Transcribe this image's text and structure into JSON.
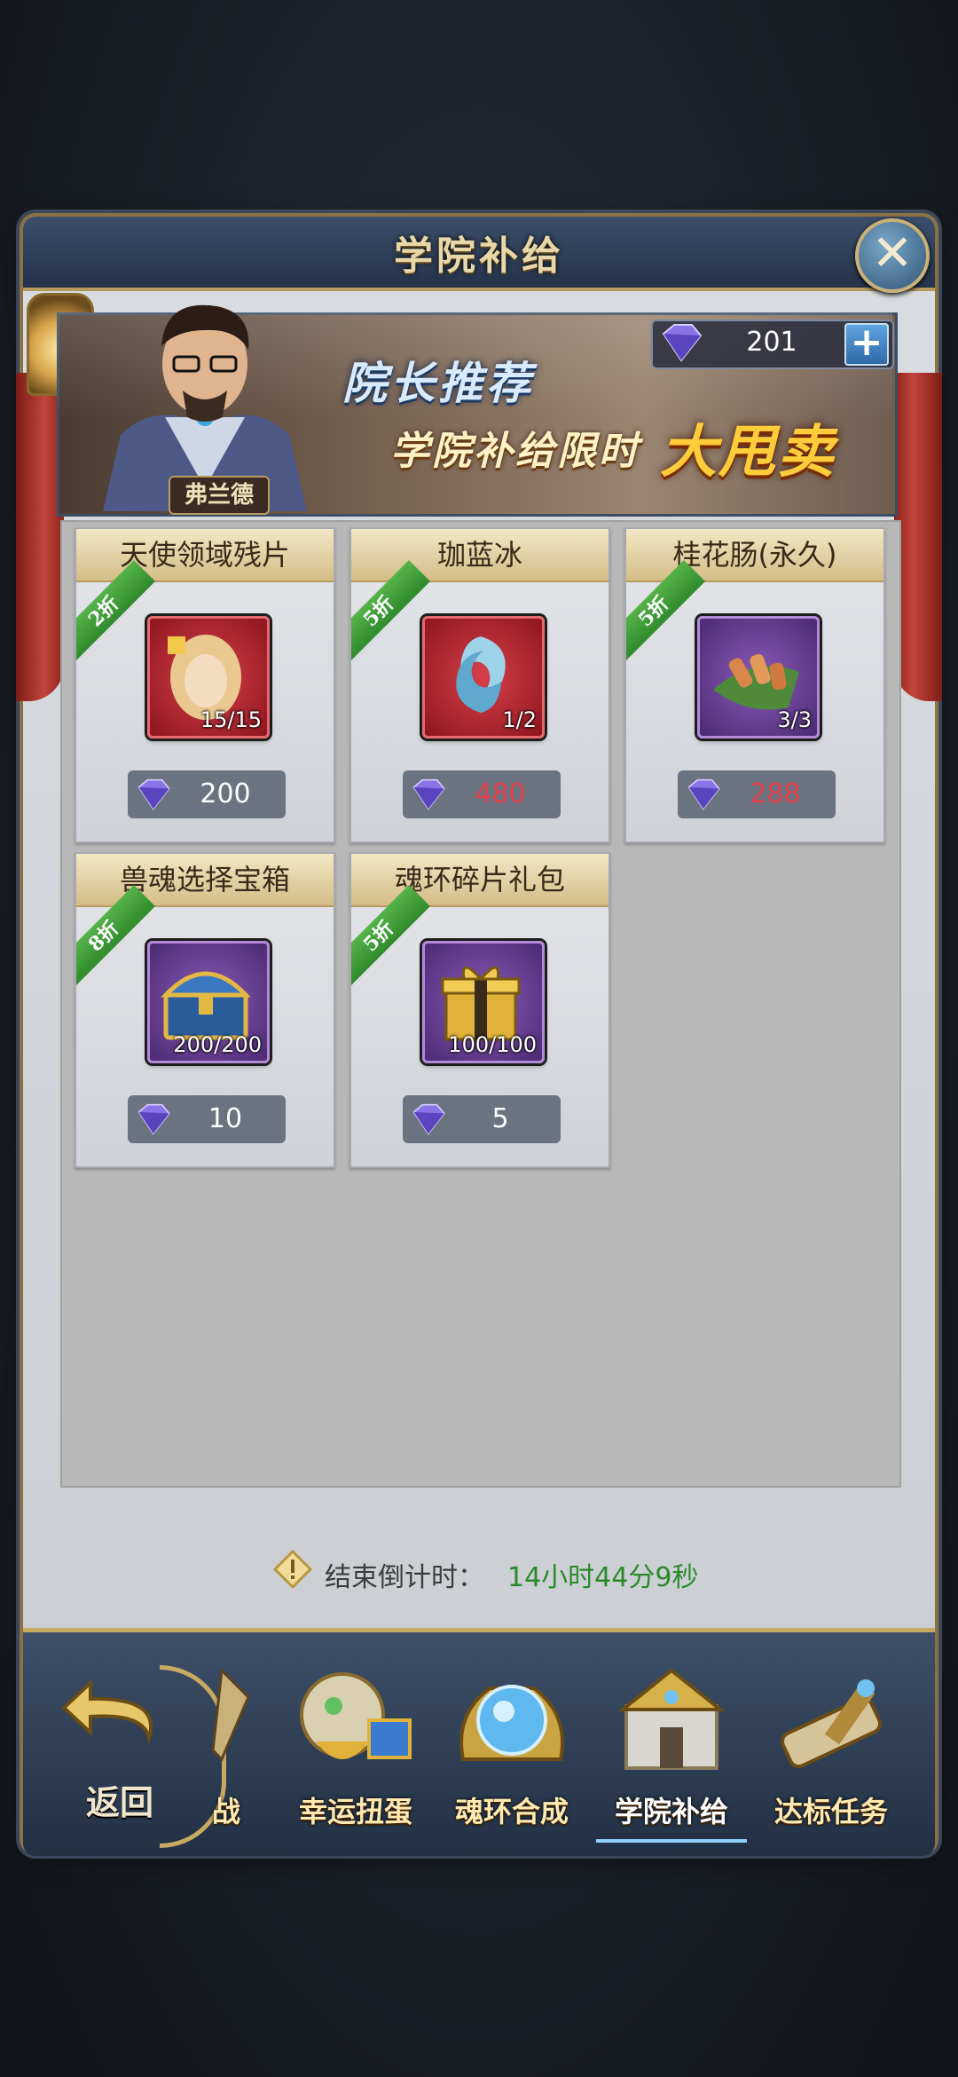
{
  "window": {
    "title": "学院补给",
    "close_label": "✕"
  },
  "banner": {
    "character_name": "弗兰德",
    "headline": "院长推荐",
    "subline": "学院补给限时",
    "highlight": "大甩卖"
  },
  "currency": {
    "value": "201",
    "add_label": "+"
  },
  "items": [
    {
      "name": "天使领域残片",
      "discount": "2折",
      "count": "15/15",
      "price": "200",
      "price_style": "normal",
      "icon": "angel-portrait-icon",
      "frame": "red"
    },
    {
      "name": "珈蓝冰",
      "discount": "5折",
      "count": "1/2",
      "price": "480",
      "price_style": "red",
      "icon": "ice-swirl-icon",
      "frame": "red"
    },
    {
      "name": "桂花肠(永久)",
      "discount": "5折",
      "count": "3/3",
      "price": "288",
      "price_style": "red",
      "icon": "sausage-food-icon",
      "frame": "purple"
    },
    {
      "name": "兽魂选择宝箱",
      "discount": "8折",
      "count": "200/200",
      "price": "10",
      "price_style": "normal",
      "icon": "treasure-chest-icon",
      "frame": "purple"
    },
    {
      "name": "魂环碎片礼包",
      "discount": "5折",
      "count": "100/100",
      "price": "5",
      "price_style": "normal",
      "icon": "gift-box-icon",
      "frame": "purple"
    }
  ],
  "countdown": {
    "label": "结束倒计时：",
    "value": "14小时44分9秒"
  },
  "nav": {
    "back_label": "返回",
    "items": [
      {
        "label": "战",
        "icon": "sword-icon"
      },
      {
        "label": "幸运扭蛋",
        "icon": "gacha-capsule-icon"
      },
      {
        "label": "魂环合成",
        "icon": "crystal-orb-icon"
      },
      {
        "label": "学院补给",
        "icon": "academy-building-icon",
        "active": true
      },
      {
        "label": "达标任务",
        "icon": "telescope-scroll-icon"
      }
    ]
  },
  "colors": {
    "accent_gold": "#c8aa63",
    "price_red": "#e6404c",
    "countdown_green": "#2a8a2a",
    "ribbon_green": "#3f9e38"
  }
}
